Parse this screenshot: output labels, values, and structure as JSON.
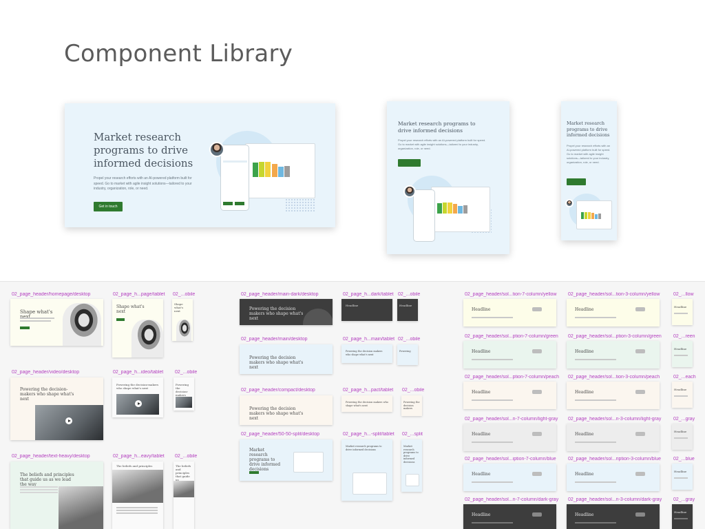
{
  "page": {
    "title": "Component Library"
  },
  "hero": {
    "headline": "Market research programs to drive informed decisions",
    "body": "Propel your research efforts with an AI-powered platform built for speed. Go to market with agile insight solutions—tailored to your industry, organization, role, or need.",
    "button": "Get in touch"
  },
  "hero_bars": {
    "colors": [
      "#3ca34a",
      "#c6d62e",
      "#f2d23d",
      "#f3a84c",
      "#6fb8e0",
      "#9c9c9c"
    ],
    "values": [
      0.7,
      0.75,
      0.72,
      0.62,
      0.5,
      0.55
    ]
  },
  "gallery": {
    "col1": [
      {
        "label": "02_page_header/homepage/desktop",
        "headline": "Shape what's next"
      },
      {
        "label": "02_page_h...page/tablet",
        "headline": "Shape what's next"
      },
      {
        "label": "02_...obile",
        "headline": "Shape what's next"
      },
      {
        "label": "02_page_header/video/desktop",
        "headline": "Powering the decision-makers who shape what's next"
      },
      {
        "label": "02_page_h...ideo/tablet",
        "headline": "Powering the decision-makers who shape what's next"
      },
      {
        "label": "02_...obile",
        "headline": "Powering the decision-makers"
      },
      {
        "label": "02_page_header/text-heavy/desktop",
        "headline": "The beliefs and principles that guide us as we lead the way"
      },
      {
        "label": "02_page_h...eavy/tablet",
        "headline": "The beliefs and principles"
      },
      {
        "label": "02_...obile",
        "headline": "The beliefs and principles that guide us"
      }
    ],
    "col2": [
      {
        "label": "02_page_header/main-dark/desktop",
        "headline": "Powering the decision makers who shape what's next"
      },
      {
        "label": "02_page_h...dark/tablet",
        "headline": "Headline"
      },
      {
        "label": "02_...obile",
        "headline": "Headline"
      },
      {
        "label": "02_page_header/main/desktop",
        "headline": "Powering the decision makers who shape what's next"
      },
      {
        "label": "02_page_h...main/tablet",
        "headline": "Powering the decision makers who shape what's next"
      },
      {
        "label": "02_...obile",
        "headline": "Powering"
      },
      {
        "label": "02_page_header/compact/desktop",
        "headline": "Powering the decision makers who shape what's next"
      },
      {
        "label": "02_page_h...pact/tablet",
        "headline": "Powering the decision makers who shape what's next"
      },
      {
        "label": "02_...obile",
        "headline": "Powering the decision makers"
      },
      {
        "label": "02_page_header/50-50-split/desktop",
        "headline": "Market research programs to drive informed decisions"
      },
      {
        "label": "02_page_h...-split/tablet",
        "headline": "Market research programs to drive informed decisions"
      },
      {
        "label": "02_...split",
        "headline": "Market research programs to drive informed decisions"
      }
    ],
    "col3": [
      {
        "label": "02_page_header/sol...tion-7-column/yellow",
        "label2": "02_page_header/sol...tion-3-column/yellow",
        "label3": "02_...llow"
      },
      {
        "label": "02_page_header/sol...ption-7-column/green",
        "label2": "02_page_header/sol...ption-3-column/green",
        "label3": "02_...reen"
      },
      {
        "label": "02_page_header/sol...ption-7-column/peach",
        "label2": "02_page_header/sol...tion-3-column/peach",
        "label3": "02_...each"
      },
      {
        "label": "02_page_header/sol...n-7-column/light-gray",
        "label2": "02_page_header/sol...n-3-column/light-gray",
        "label3": "02_...gray"
      },
      {
        "label": "02_page_header/sol...iption-7-column/blue",
        "label2": "02_page_header/sol...ription-3-column/blue",
        "label3": "02_...blue"
      },
      {
        "label": "02_page_header/sol...n-7-column/dark-gray",
        "label2": "02_page_header/sol...n-3-column/dark-gray",
        "label3": "02_...gray"
      }
    ],
    "solution_headline": "Headline"
  }
}
